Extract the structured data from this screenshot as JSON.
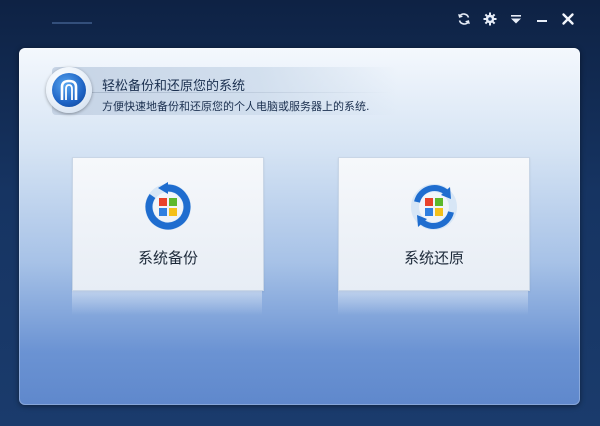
{
  "window": {
    "controls": [
      {
        "icon": "refresh-icon"
      },
      {
        "icon": "gear-icon"
      },
      {
        "icon": "menu-dropdown-icon"
      },
      {
        "icon": "minimize-icon"
      },
      {
        "icon": "close-icon"
      }
    ]
  },
  "header": {
    "logo_icon": "shield-logo-icon",
    "title": "轻松备份和还原您的系统",
    "subtitle": "方便快速地备份和还原您的个人电脑或服务器上的系统."
  },
  "actions": {
    "backup": {
      "label": "系统备份",
      "icon": "backup-icon"
    },
    "restore": {
      "label": "系统还原",
      "icon": "restore-icon"
    }
  },
  "colors": {
    "frame": "#163462",
    "panel_top": "#f4f8fd",
    "panel_bottom": "#5f88cc",
    "accent_blue": "#1e63c4",
    "windows_red": "#e8422a",
    "windows_green": "#5cb82c",
    "windows_blue": "#2f7fe0",
    "windows_yellow": "#f4c01a"
  }
}
